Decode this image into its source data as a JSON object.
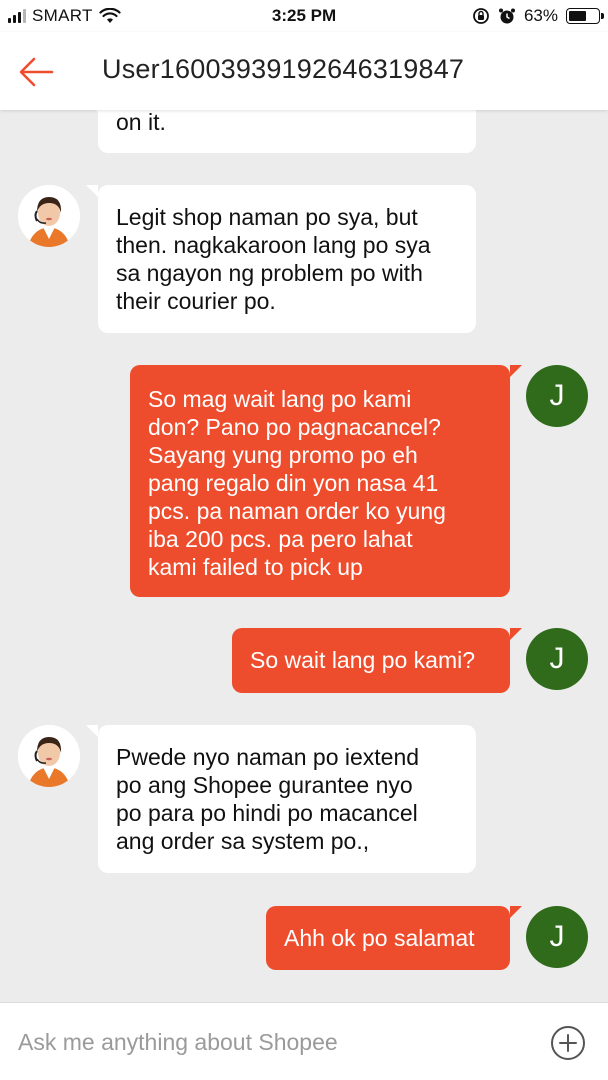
{
  "status_bar": {
    "carrier": "SMART",
    "time": "3:25 PM",
    "battery_percent": "63%",
    "battery_level": 0.63,
    "icons": [
      "signal-icon",
      "wifi-icon",
      "orientation-lock-icon",
      "alarm-icon",
      "battery-icon"
    ]
  },
  "header": {
    "back_icon": "back-arrow-icon",
    "title": "User16003939192646319847"
  },
  "messages": [
    {
      "sender": "agent",
      "avatar": "agent-avatar",
      "lines": [
        "on it."
      ]
    },
    {
      "sender": "agent",
      "avatar": "agent-avatar",
      "lines": [
        "Legit shop naman po sya, but",
        "then. nagkakaroon lang po sya",
        "sa ngayon ng problem po with",
        "their courier po."
      ]
    },
    {
      "sender": "user",
      "avatar_initial": "J",
      "lines": [
        "So mag wait lang po kami",
        "don? Pano po pagnacancel?",
        "Sayang yung promo po eh",
        "pang regalo din yon nasa 41",
        "pcs. pa naman order ko yung",
        "iba 200 pcs. pa pero lahat",
        "kami failed to pick up"
      ]
    },
    {
      "sender": "user",
      "avatar_initial": "J",
      "lines": [
        "So wait lang po kami?"
      ]
    },
    {
      "sender": "agent",
      "avatar": "agent-avatar",
      "lines": [
        "Pwede nyo naman po iextend",
        "po ang Shopee gurantee nyo",
        "po para po hindi po macancel",
        "ang order sa system po.,"
      ]
    },
    {
      "sender": "user",
      "avatar_initial": "J",
      "lines": [
        "Ahh ok po salamat"
      ]
    }
  ],
  "input": {
    "placeholder": "Ask me anything about Shopee",
    "add_icon": "plus-circle-icon"
  },
  "colors": {
    "accent": "#ee4d2d",
    "user_avatar": "#2f6b1b",
    "background": "#ececec"
  }
}
